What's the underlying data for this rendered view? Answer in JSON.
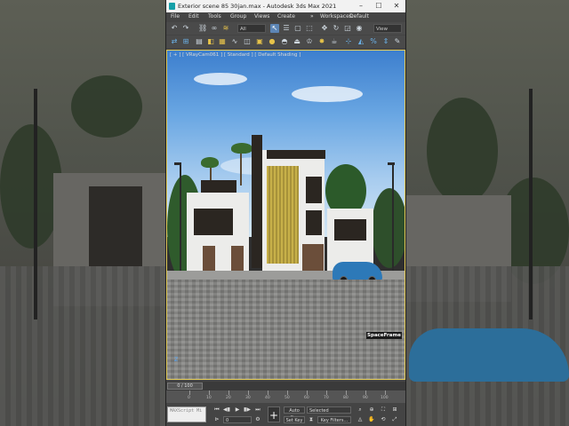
{
  "window": {
    "title": "Exterior scene 85 30jan.max - Autodesk 3ds Max 2021",
    "minimize": "–",
    "maximize": "☐",
    "close": "✕"
  },
  "menu": {
    "items": [
      "File",
      "Edit",
      "Tools",
      "Group",
      "Views",
      "Create"
    ],
    "more": "»",
    "workspace_label": "Workspaces:",
    "workspace_value": "Default"
  },
  "toolbar": {
    "filter_dropdown": "All",
    "view_dropdown": "View"
  },
  "viewport": {
    "label": "[ + ] [ VRayCam061 ] [ Standard ] [ Default Shading ]",
    "watermark": "SpaceFrame",
    "axis": "Z"
  },
  "timeline": {
    "frame_display": "0 / 100",
    "ticks": [
      "0",
      "10",
      "20",
      "30",
      "40",
      "50",
      "60",
      "70",
      "80",
      "90",
      "100"
    ]
  },
  "status": {
    "maxscript_label": "MAXScript Mi",
    "auto_key": "Auto Key",
    "selected_value": "Selected",
    "set_key": "Set Key",
    "key_filters": "Key Filters...",
    "frame_value": "0"
  },
  "colors": {
    "accent": "#5d86b6",
    "viewport_border": "#e3cc5a"
  }
}
